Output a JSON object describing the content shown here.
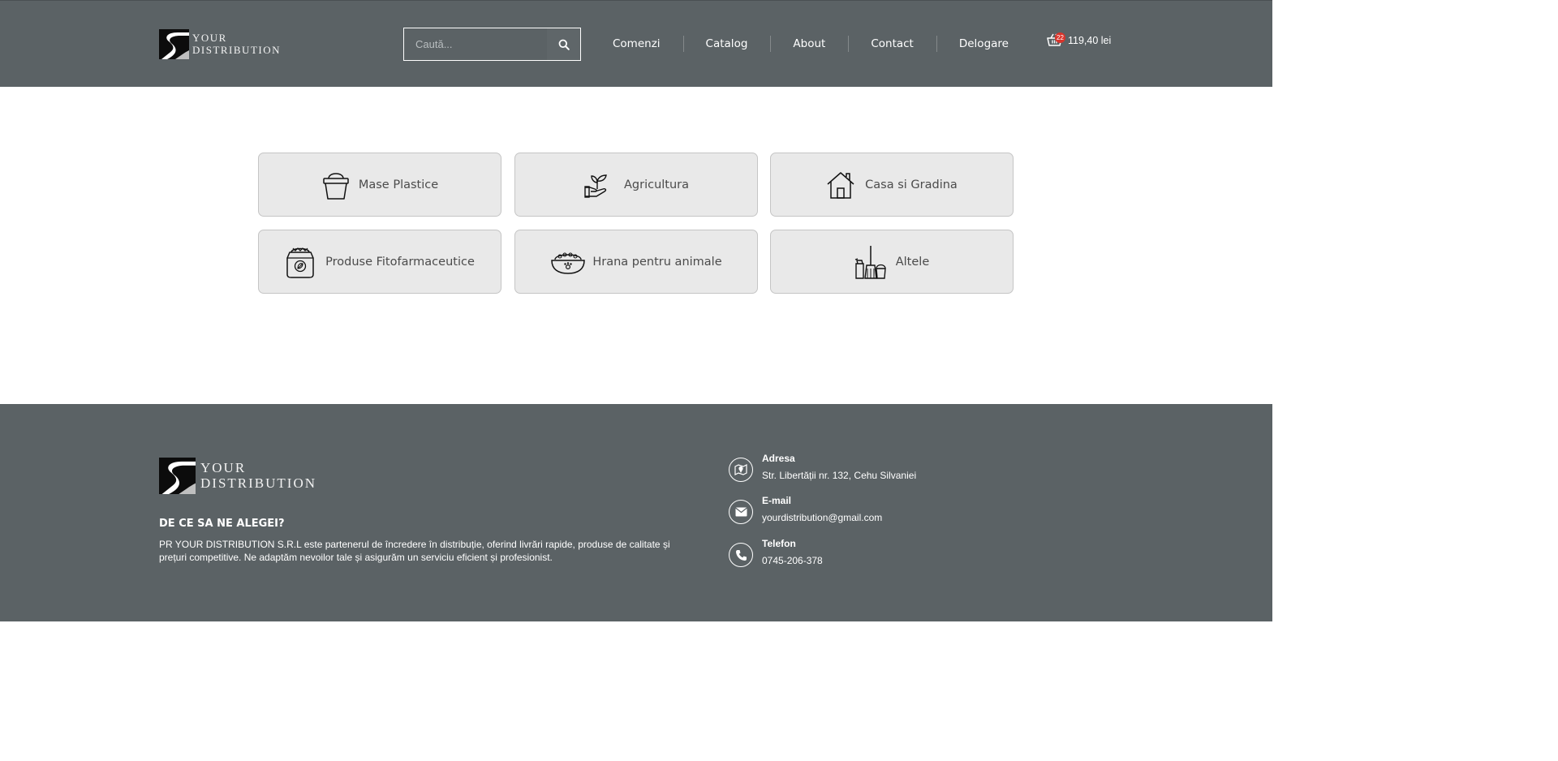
{
  "brand": {
    "line1": "YOUR",
    "line2": "DISTRIBUTION"
  },
  "search": {
    "placeholder": "Caută..."
  },
  "nav": {
    "items": [
      "Comenzi",
      "Catalog",
      "About",
      "Contact",
      "Delogare"
    ]
  },
  "cart": {
    "count": "22",
    "total": "119,40 lei"
  },
  "categories": [
    {
      "label": "Mase Plastice",
      "icon": "bucket-icon"
    },
    {
      "label": "Agricultura",
      "icon": "plant-hand-icon"
    },
    {
      "label": "Casa si Gradina",
      "icon": "house-icon"
    },
    {
      "label": "Produse Fitofarmaceutice",
      "icon": "fertilizer-sack-icon"
    },
    {
      "label": "Hrana pentru animale",
      "icon": "pet-food-bowl-icon"
    },
    {
      "label": "Altele",
      "icon": "cleaning-supplies-icon"
    }
  ],
  "footer": {
    "why_title": "DE CE SA NE ALEGEI?",
    "why_text": "PR YOUR DISTRIBUTION S.R.L este partenerul de încredere în distribuție, oferind livrări rapide, produse de calitate și prețuri competitive. Ne adaptăm nevoilor tale și asigurăm un serviciu eficient și profesionist.",
    "contacts": [
      {
        "title": "Adresa",
        "value": "Str. Libertății nr. 132, Cehu Silvaniei",
        "icon": "map-icon"
      },
      {
        "title": "E-mail",
        "value": "yourdistribution@gmail.com",
        "icon": "envelope-icon"
      },
      {
        "title": "Telefon",
        "value": "0745-206-378",
        "icon": "phone-icon"
      }
    ]
  },
  "colors": {
    "header_bg": "#5b6265",
    "card_bg": "#e9e9e9",
    "badge": "#d9342b"
  }
}
